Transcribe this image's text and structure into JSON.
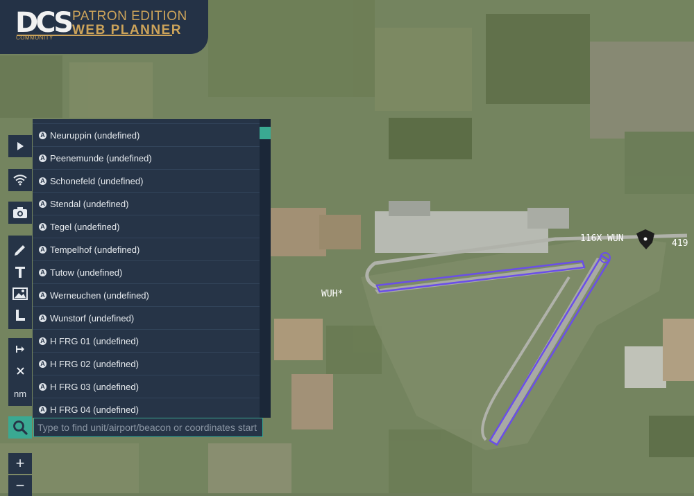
{
  "logo": {
    "dcs": "DCS",
    "community": "COMMUNITY",
    "patron": "PATRON EDITION",
    "web": "WEB PLANNER"
  },
  "toolbar": {
    "icons": [
      "play-icon",
      "wifi-icon",
      "camera-icon",
      "pencil-icon",
      "text-icon",
      "image-icon",
      "ruler-icon",
      "measure-icon",
      "close-icon"
    ],
    "units_label": "nm"
  },
  "search": {
    "placeholder": "Type to find unit/airport/beacon or coordinates start",
    "value": "",
    "results": [
      {
        "label": "Neuruppin (undefined)"
      },
      {
        "label": "Peenemunde (undefined)"
      },
      {
        "label": "Schonefeld (undefined)"
      },
      {
        "label": "Stendal (undefined)"
      },
      {
        "label": "Tegel (undefined)"
      },
      {
        "label": "Tempelhof (undefined)"
      },
      {
        "label": "Tutow (undefined)"
      },
      {
        "label": "Werneuchen (undefined)"
      },
      {
        "label": "Wunstorf (undefined)"
      },
      {
        "label": "H FRG 01 (undefined)"
      },
      {
        "label": "H FRG 02 (undefined)"
      },
      {
        "label": "H FRG 03 (undefined)"
      },
      {
        "label": "H FRG 04 (undefined)"
      }
    ]
  },
  "zoom": {
    "in_label": "+",
    "out_label": "−"
  },
  "map_labels": {
    "tacan": "116X WUN",
    "tacan_partial": "419",
    "airfield_code": "WUH*"
  },
  "colors": {
    "panel": "#263447",
    "accent": "#3aa992",
    "runway_outline": "#6a4ee8",
    "gold": "#cda45a"
  }
}
